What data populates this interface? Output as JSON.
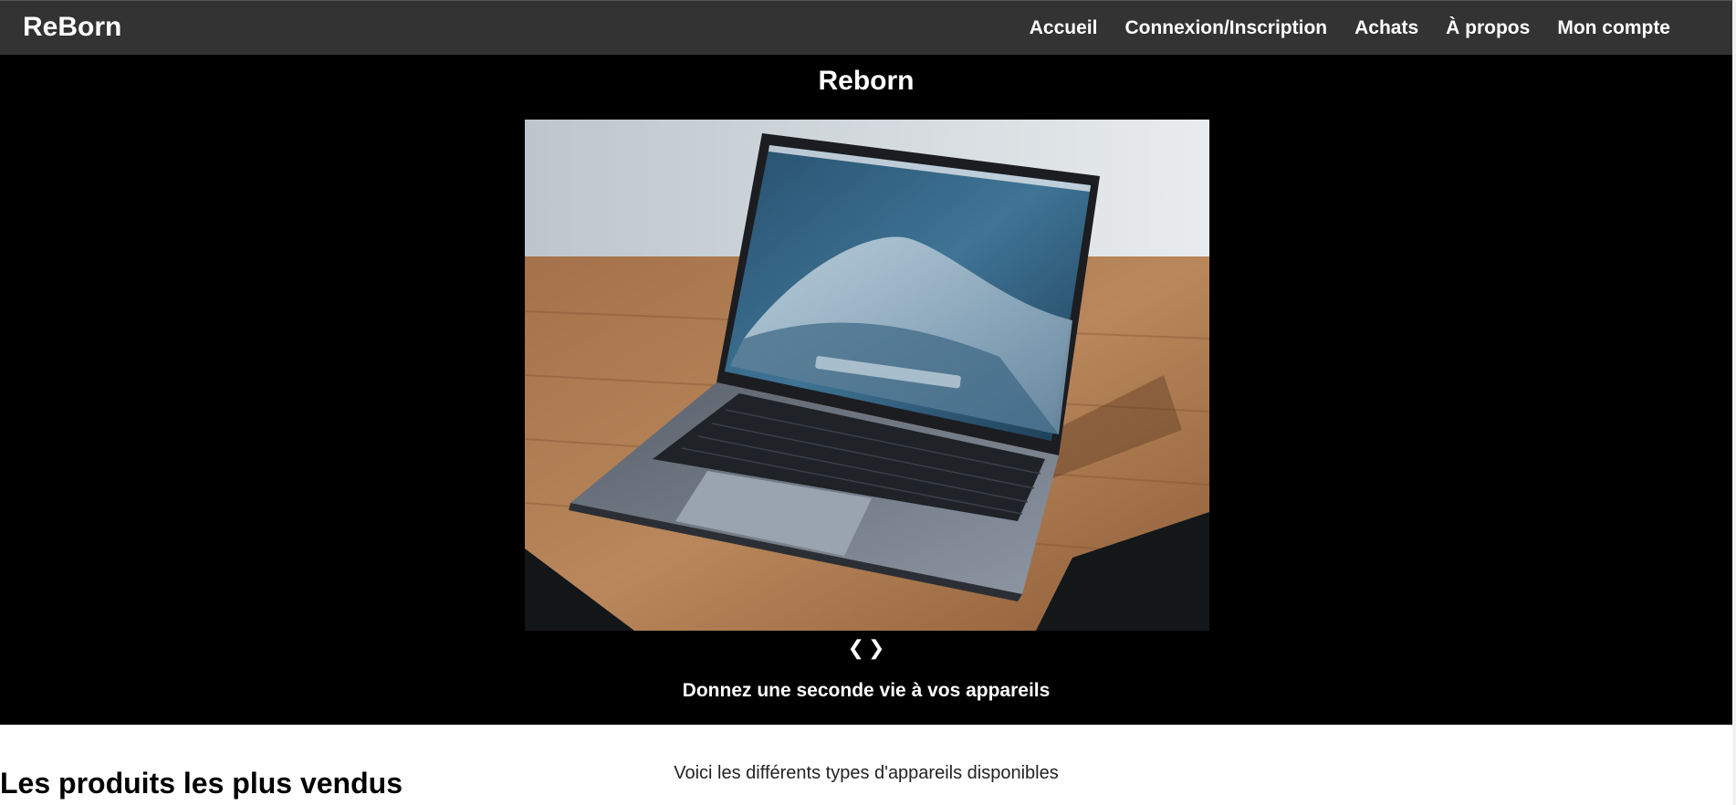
{
  "header": {
    "brand": "ReBorn",
    "nav": [
      {
        "label": "Accueil"
      },
      {
        "label": "Connexion/Inscription"
      },
      {
        "label": "Achats"
      },
      {
        "label": "À propos"
      },
      {
        "label": "Mon compte"
      }
    ]
  },
  "hero": {
    "title": "Reborn",
    "carousel": {
      "image_subject": "laptop on wooden desk",
      "prev_label": "❮",
      "next_label": "❯"
    },
    "tagline": "Donnez une seconde vie à vos appareils"
  },
  "main": {
    "subtitle": "Voici les différents types d'appareils disponibles",
    "section_title": "Les produits les plus vendus"
  },
  "colors": {
    "navbar": "#333333",
    "hero_background": "#000000",
    "text_light": "#ffffff",
    "text_dark": "#000000"
  }
}
